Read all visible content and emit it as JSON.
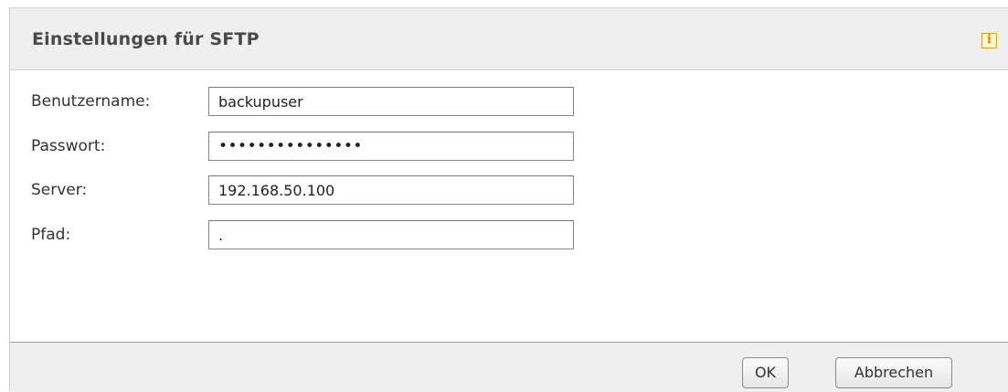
{
  "dialog": {
    "title": "Einstellungen für SFTP",
    "info_icon": "info-icon"
  },
  "form": {
    "fields": [
      {
        "label": "Benutzername:",
        "value": "backupuser",
        "type": "text"
      },
      {
        "label": "Passwort:",
        "value": "•••••••••••••••",
        "type": "password"
      },
      {
        "label": "Server:",
        "value": "192.168.50.100",
        "type": "text"
      },
      {
        "label": "Pfad:",
        "value": ".",
        "type": "text"
      }
    ]
  },
  "buttons": {
    "ok_label": "OK",
    "cancel_label": "Abbrechen"
  }
}
